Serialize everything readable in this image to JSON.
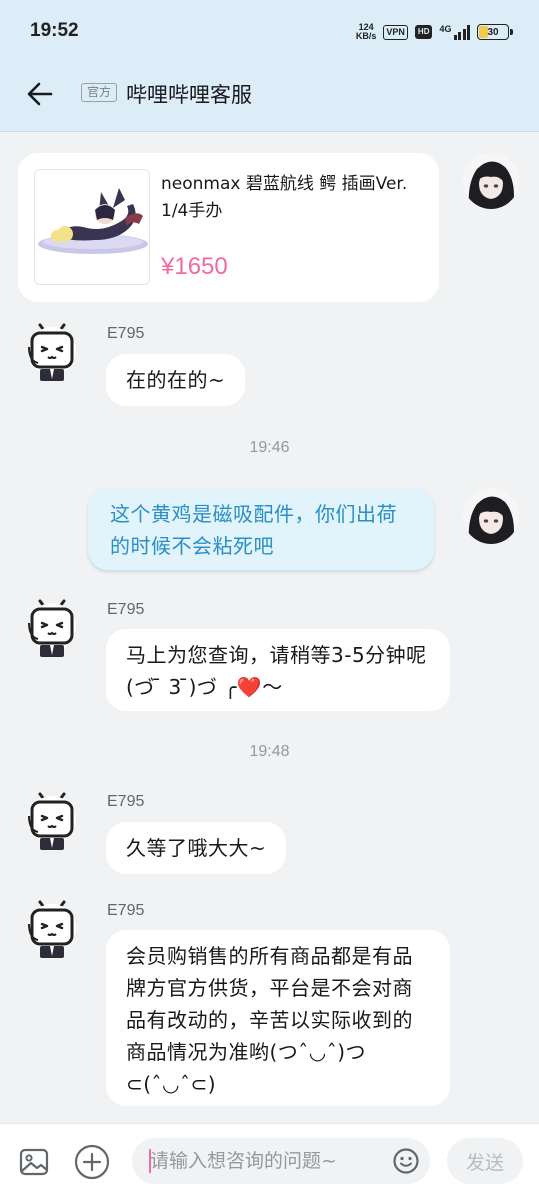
{
  "status_bar": {
    "time": "19:52",
    "net_speed_value": "124",
    "net_speed_unit": "KB/s",
    "vpn_label": "VPN",
    "hd_label": "HD",
    "network_type": "4G",
    "battery_level": "30"
  },
  "header": {
    "official_tag": "官方",
    "title": "哔哩哔哩客服"
  },
  "product": {
    "name": "neonmax 碧蓝航线 鳄 插画Ver. 1/4手办",
    "price": "¥1650"
  },
  "messages": [
    {
      "sender": "E795",
      "text": "在的在的~"
    },
    {
      "time": "19:46"
    },
    {
      "self": true,
      "text": "这个黄鸡是磁吸配件，你们出荷的时候不会粘死吧"
    },
    {
      "sender": "E795",
      "text": "马上为您查询，请稍等3-5分钟呢(づ ̄ 3 ̄)づ ╭❤️～"
    },
    {
      "time": "19:48"
    },
    {
      "sender": "E795",
      "text": "久等了哦大大~"
    },
    {
      "sender": "E795",
      "text": "会员购销售的所有商品都是有品牌方官方供货，平台是不会对商品有改动的，辛苦以实际收到的商品情况为准哟(つˆ◡ˆ)つ⊂(ˆ◡ˆ⊂)"
    }
  ],
  "input_bar": {
    "placeholder": "请输入想咨询的问题~",
    "send_label": "发送"
  },
  "icons": {
    "back": "back-arrow-icon",
    "image": "image-icon",
    "add": "plus-circle-icon",
    "emoji": "emoji-icon"
  },
  "colors": {
    "header_bg": "#dcedf8",
    "price": "#f06ba0",
    "self_bubble_bg": "#e1f3fb",
    "self_bubble_text": "#2a8fc4",
    "battery_fill": "#f2c94c"
  }
}
